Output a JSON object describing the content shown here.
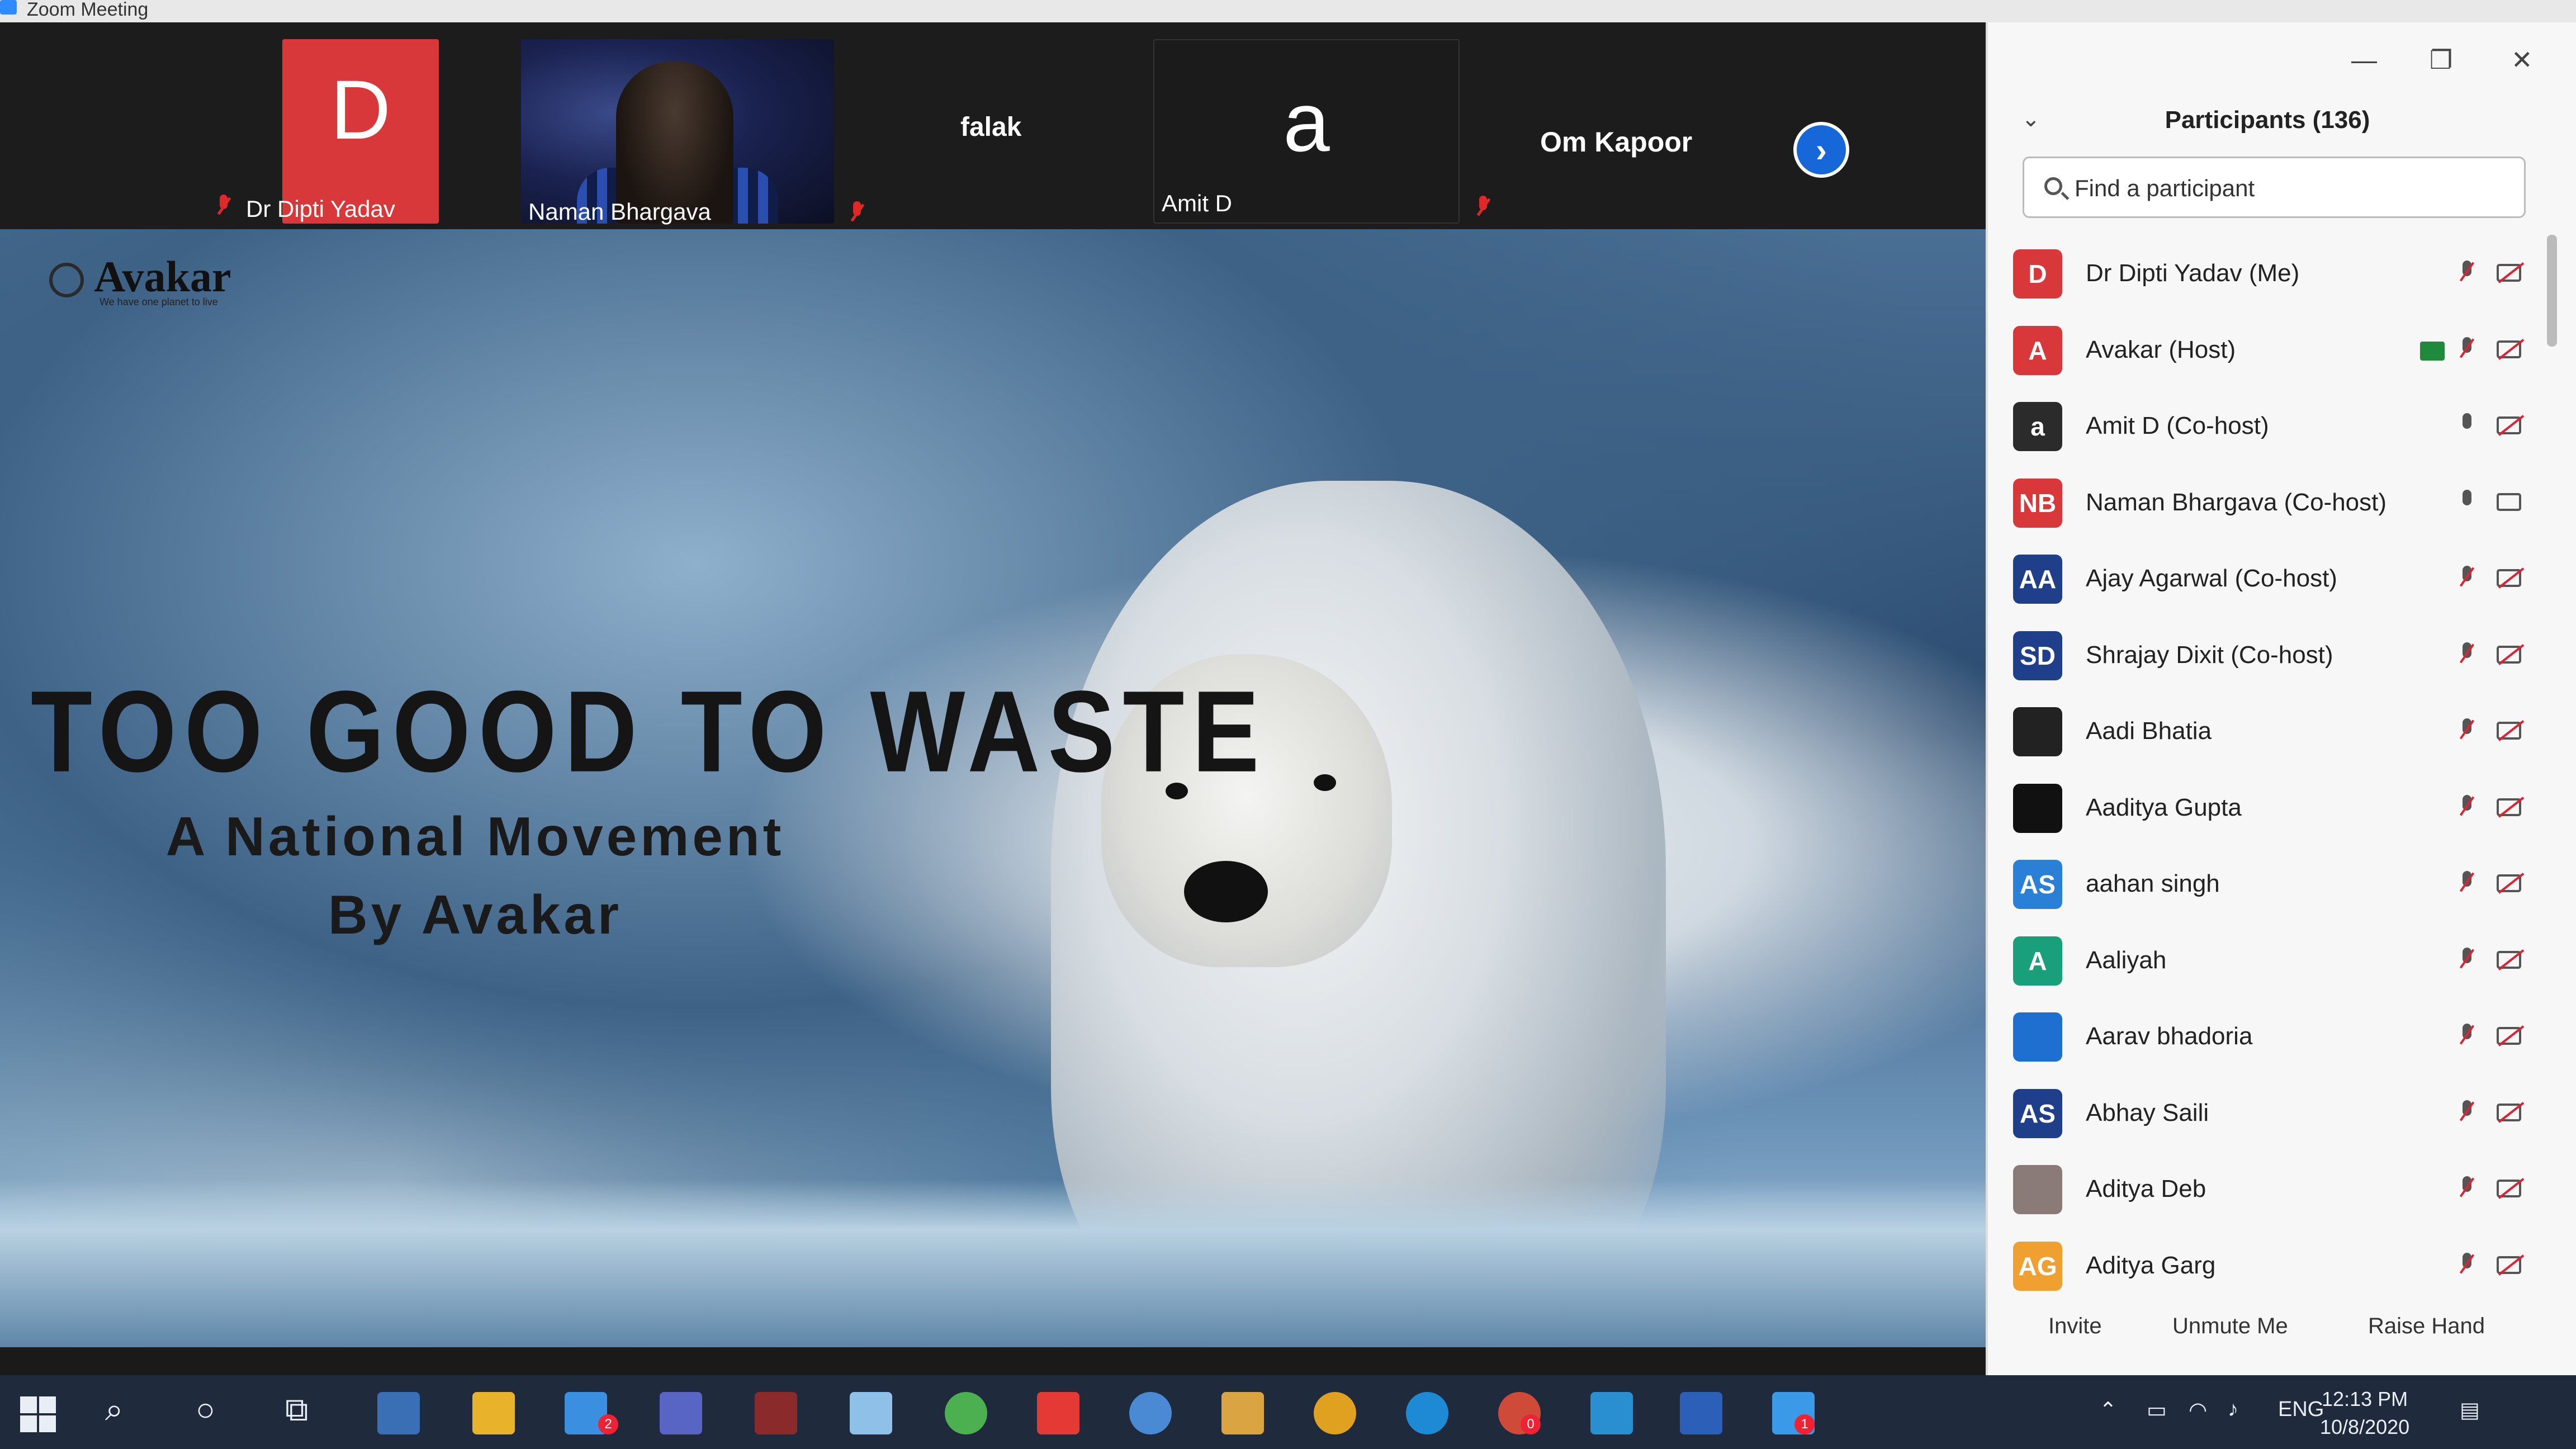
{
  "window": {
    "title": "Zoom Meeting"
  },
  "gallery": {
    "tiles": [
      {
        "name": "Dr Dipti Yadav",
        "initial": "D"
      },
      {
        "name": "Naman Bhargava"
      },
      {
        "name": "falak"
      },
      {
        "name": "Amit D",
        "initial": "a"
      },
      {
        "name": "Om Kapoor"
      }
    ]
  },
  "slide": {
    "logo": "Avakar",
    "logo_tagline": "We have one planet to live",
    "title": "TOO GOOD TO WASTE",
    "subtitle_line1": "A National Movement",
    "subtitle_line2": "By Avakar"
  },
  "participants": {
    "header": "Participants (136)",
    "search_placeholder": "Find a participant",
    "items": [
      {
        "name": "Dr Dipti Yadav (Me)",
        "initials": "D",
        "color": "#d9383a",
        "mic": "off",
        "cam": "off"
      },
      {
        "name": "Avakar (Host)",
        "initials": "A",
        "color": "#d9383a",
        "mic": "off",
        "cam": "off",
        "sharing": true
      },
      {
        "name": "Amit D (Co-host)",
        "initials": "a",
        "color": "#2b2b2b",
        "mic": "on",
        "cam": "off"
      },
      {
        "name": "Naman Bhargava (Co-host)",
        "initials": "NB",
        "color": "#d9383a",
        "mic": "on",
        "cam": "on"
      },
      {
        "name": "Ajay Agarwal (Co-host)",
        "initials": "AA",
        "color": "#1f3f8a",
        "mic": "off",
        "cam": "off"
      },
      {
        "name": "Shrajay Dixit (Co-host)",
        "initials": "SD",
        "color": "#1f3f8a",
        "mic": "off",
        "cam": "off"
      },
      {
        "name": "Aadi Bhatia",
        "initials": "",
        "color": "#222222",
        "mic": "off",
        "cam": "off"
      },
      {
        "name": "Aaditya Gupta",
        "initials": "",
        "color": "#111111",
        "mic": "off",
        "cam": "off"
      },
      {
        "name": "aahan singh",
        "initials": "AS",
        "color": "#2a7fd6",
        "mic": "off",
        "cam": "off"
      },
      {
        "name": "Aaliyah",
        "initials": "A",
        "color": "#19a07a",
        "mic": "off",
        "cam": "off"
      },
      {
        "name": "Aarav bhadoria",
        "initials": "",
        "color": "#1f6fd0",
        "mic": "off",
        "cam": "off"
      },
      {
        "name": "Abhay Saili",
        "initials": "AS",
        "color": "#1f3f8a",
        "mic": "off",
        "cam": "off"
      },
      {
        "name": "Aditya Deb",
        "initials": "",
        "color": "#8a7a78",
        "mic": "off",
        "cam": "off"
      },
      {
        "name": "Aditya Garg",
        "initials": "AG",
        "color": "#f0a030",
        "mic": "off",
        "cam": "off"
      }
    ],
    "footer": {
      "invite": "Invite",
      "unmute": "Unmute Me",
      "raise_hand": "Raise Hand"
    }
  },
  "taskbar": {
    "lang": "ENG",
    "time": "12:13 PM",
    "date": "10/8/2020",
    "mail_badge": "2",
    "chrome_badge": "0",
    "zoom_badge": "1"
  }
}
